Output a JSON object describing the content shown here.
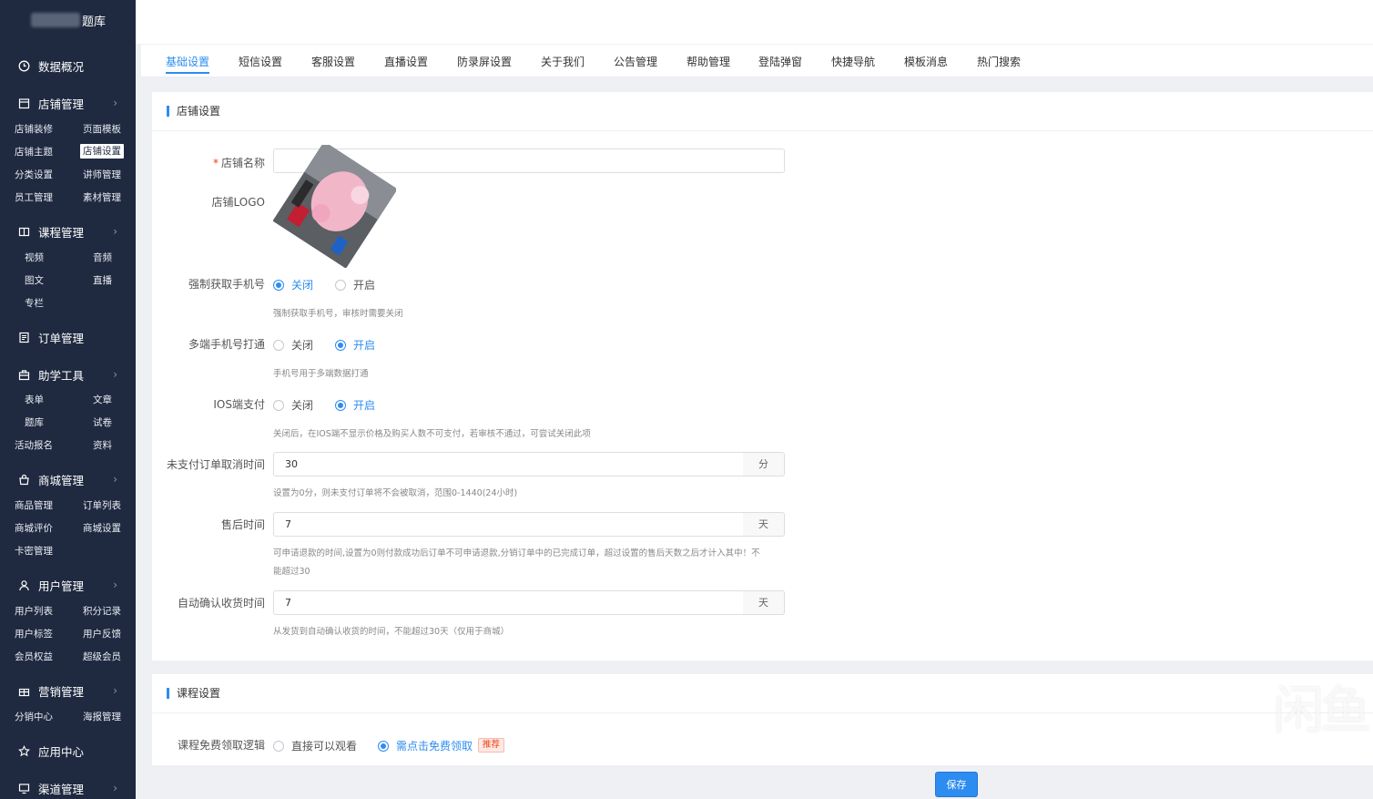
{
  "brand": {
    "title": "题库"
  },
  "sidebar": {
    "top_item": "数据概况",
    "groups": [
      {
        "label": "店铺管理",
        "items": [
          "店铺装修",
          "页面模板",
          "店铺主题",
          "店铺设置",
          "分类设置",
          "讲师管理",
          "员工管理",
          "素材管理"
        ],
        "active": "店铺设置"
      },
      {
        "label": "课程管理",
        "items": [
          "视频",
          "音频",
          "图文",
          "直播",
          "专栏"
        ]
      },
      {
        "label": "订单管理",
        "items": []
      },
      {
        "label": "助学工具",
        "items": [
          "表单",
          "文章",
          "题库",
          "试卷",
          "活动报名",
          "资料"
        ]
      },
      {
        "label": "商城管理",
        "items": [
          "商品管理",
          "订单列表",
          "商城评价",
          "商城设置",
          "卡密管理"
        ]
      },
      {
        "label": "用户管理",
        "items": [
          "用户列表",
          "积分记录",
          "用户标签",
          "用户反馈",
          "会员权益",
          "超级会员"
        ]
      },
      {
        "label": "营销管理",
        "items": [
          "分销中心",
          "海报管理"
        ]
      },
      {
        "label": "应用中心",
        "items": []
      },
      {
        "label": "渠道管理",
        "items": []
      }
    ]
  },
  "tabs": [
    "基础设置",
    "短信设置",
    "客服设置",
    "直播设置",
    "防录屏设置",
    "关于我们",
    "公告管理",
    "帮助管理",
    "登陆弹窗",
    "快捷导航",
    "模板消息",
    "热门搜索"
  ],
  "active_tab": "基础设置",
  "store_settings": {
    "title": "店铺设置",
    "name_label": "店铺名称",
    "name_value": "",
    "logo_label": "店铺LOGO",
    "force_phone": {
      "label": "强制获取手机号",
      "off": "关闭",
      "on": "开启",
      "selected": "关闭",
      "hint": "强制获取手机号，审核时需要关闭"
    },
    "multi_phone": {
      "label": "多端手机号打通",
      "off": "关闭",
      "on": "开启",
      "selected": "开启",
      "hint": "手机号用于多端数据打通"
    },
    "ios_pay": {
      "label": "IOS端支付",
      "off": "关闭",
      "on": "开启",
      "selected": "开启",
      "hint": "关闭后，在IOS端不显示价格及购买人数不可支付，若审核不通过，可尝试关闭此项"
    },
    "unpaid_cancel": {
      "label": "未支付订单取消时间",
      "value": "30",
      "unit": "分",
      "hint": "设置为0分，则未支付订单将不会被取消，范围0-1440(24小时)"
    },
    "after_sale": {
      "label": "售后时间",
      "value": "7",
      "unit": "天",
      "hint_line1": "可申请退款的时间,设置为0则付款成功后订单不可申请退款,分销订单中的已完成订单，超过设置的售后天数之后才计入其中！不",
      "hint_line2": "能超过30"
    },
    "auto_confirm": {
      "label": "自动确认收货时间",
      "value": "7",
      "unit": "天",
      "hint": "从发货到自动确认收货的时间，不能超过30天（仅用于商城）"
    }
  },
  "course_settings": {
    "title": "课程设置",
    "free_logic": {
      "label": "课程免费领取逻辑",
      "opt1": "直接可以观看",
      "opt2": "需点击免费领取",
      "selected": "需点击免费领取",
      "badge": "推荐"
    }
  },
  "save_label": "保存",
  "watermark": "闲鱼",
  "colors": {
    "sidebar": "#1f2a40",
    "accent": "#2d8cf0"
  }
}
